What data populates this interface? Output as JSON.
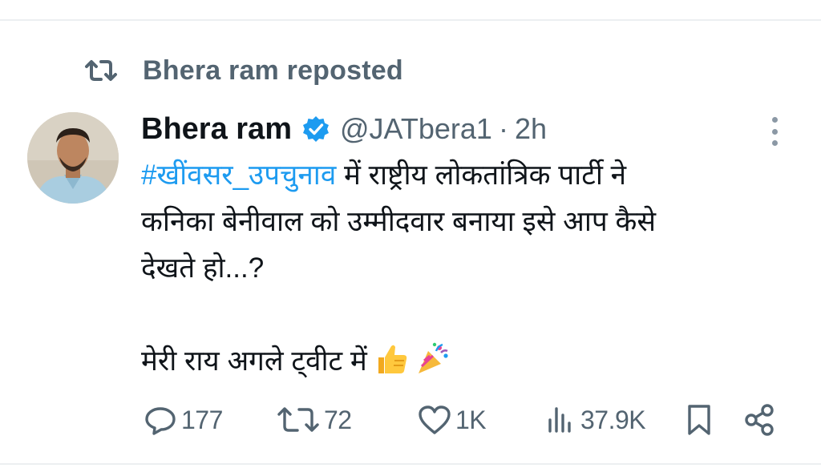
{
  "repost": {
    "text": "Bhera ram reposted",
    "icon": "repost-icon"
  },
  "author": {
    "name": "Bhera ram",
    "handle": "@JATbera1",
    "separator": "·",
    "time": "2h",
    "verified_color": "#1d9bf0"
  },
  "tweet": {
    "hashtag": "#खींवसर_उपचुनाव",
    "line1_rest": " में राष्ट्रीय लोकतांत्रिक पार्टी ने",
    "line2": "कनिका बेनीवाल को उम्मीदवार बनाया इसे आप कैसे",
    "line3": "देखते हो...?",
    "line5": "मेरी राय अगले ट्वीट में",
    "emojis": [
      "thumbs-up-emoji",
      "party-popper-emoji"
    ]
  },
  "actions": {
    "replies": "177",
    "reposts": "72",
    "likes": "1K",
    "views": "37.9K"
  },
  "colors": {
    "accent": "#1d9bf0",
    "muted": "#536471",
    "text": "#0f1419"
  }
}
